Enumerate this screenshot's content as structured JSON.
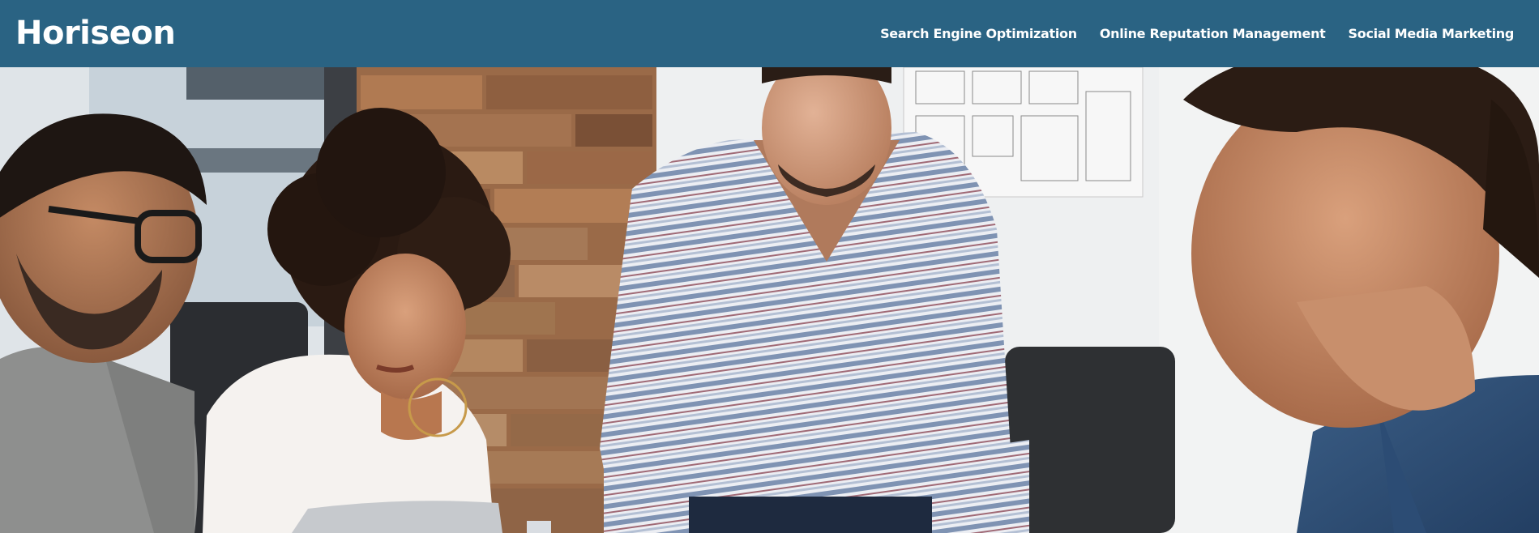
{
  "header": {
    "logo_text": "Horiseon",
    "background_color": "#2a6383",
    "nav": [
      {
        "label": "Search Engine Optimization"
      },
      {
        "label": "Online Reputation Management"
      },
      {
        "label": "Social Media Marketing"
      }
    ]
  },
  "hero": {
    "image_subject": "four people collaborating around a table in an office"
  }
}
